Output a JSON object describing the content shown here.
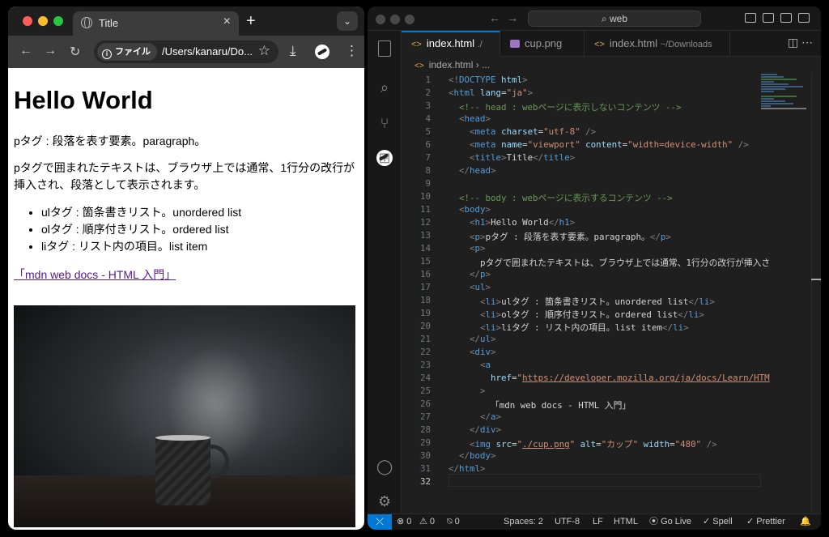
{
  "browser": {
    "tab_title": "Title",
    "tab_close": "×",
    "new_tab": "+",
    "tab_dropdown": "⌄",
    "back": "←",
    "forward": "→",
    "reload": "↻",
    "chip_label": "ファイル",
    "chip_info": "i",
    "url": "/Users/kanaru/Do...",
    "bookmark": "☆",
    "download": "⤓",
    "menu": "⋮"
  },
  "page": {
    "h1": "Hello World",
    "p1": "pタグ : 段落を表す要素。paragraph。",
    "p2": "pタグで囲まれたテキストは、ブラウザ上では通常、1行分の改行が挿入され、段落として表示されます。",
    "list": [
      "ulタグ : 箇条書きリスト。unordered list",
      "olタグ : 順序付きリスト。ordered list",
      "liタグ : リスト内の項目。list item"
    ],
    "link": "「mdn web docs - HTML 入門」"
  },
  "vscode": {
    "search": "⌕ web",
    "tabs": [
      {
        "icon": "<>",
        "label": "index.html",
        "suffix": "./",
        "close": "×"
      },
      {
        "label": "cup.png"
      },
      {
        "icon": "<>",
        "label": "index.html",
        "suffix": "~/Downloads"
      }
    ],
    "breadcrumb": {
      "icon": "<>",
      "label": "index.html",
      "sep": "›",
      "tail": "..."
    },
    "line_numbers": [
      "1",
      "2",
      "3",
      "4",
      "5",
      "6",
      "7",
      "8",
      "9",
      "10",
      "11",
      "12",
      "13",
      "14",
      "15",
      "16",
      "17",
      "18",
      "19",
      "20",
      "21",
      "22",
      "23",
      "24",
      "25",
      "26",
      "27",
      "28",
      "29",
      "30",
      "31",
      "32"
    ],
    "status": {
      "errors": "⊗ 0",
      "warnings": "⚠ 0",
      "ports": "⍉ 0",
      "spaces": "Spaces: 2",
      "encoding": "UTF-8",
      "eol": "LF",
      "language": "HTML",
      "golive": "Go Live",
      "spell": "✓ Spell",
      "prettier": "✓ Prettier",
      "bell": "🔔"
    }
  }
}
